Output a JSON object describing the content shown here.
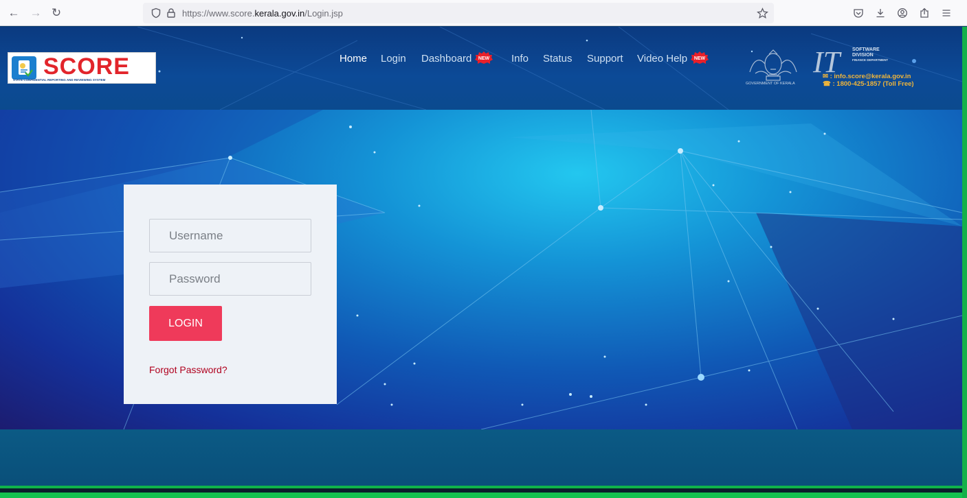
{
  "browser": {
    "url_prefix": "https://www.score.",
    "url_domain": "kerala.gov.in",
    "url_path": "/Login.jsp"
  },
  "site": {
    "logo_title": "SCORE",
    "logo_subtitle": "STATE CONFIDENTIAL REPORTING AND REVIEWING SYSTEM",
    "nav": [
      {
        "label": "Home"
      },
      {
        "label": "Login"
      },
      {
        "label": "Dashboard"
      },
      {
        "label": "Info"
      },
      {
        "label": "Status"
      },
      {
        "label": "Support"
      },
      {
        "label": "Video Help"
      }
    ],
    "new_badge": "NEW",
    "gov_caption": "GOVERNMENT OF KERALA",
    "it_mark": "IT",
    "it_line1": "SOFTWARE",
    "it_line2": "DIVISION",
    "it_line3": "FINANCE DEPARTMENT",
    "contact_email": "info.score@kerala.gov.in",
    "contact_phone": ": 1800-425-1857 (Toll Free)"
  },
  "login": {
    "username_placeholder": "Username",
    "password_placeholder": "Password",
    "button_label": "LOGIN",
    "forgot_label": "Forgot Password?"
  },
  "colors": {
    "accent_button": "#ef3a5a",
    "forgot_link": "#b0001e",
    "footer_green": "#14c24f"
  }
}
